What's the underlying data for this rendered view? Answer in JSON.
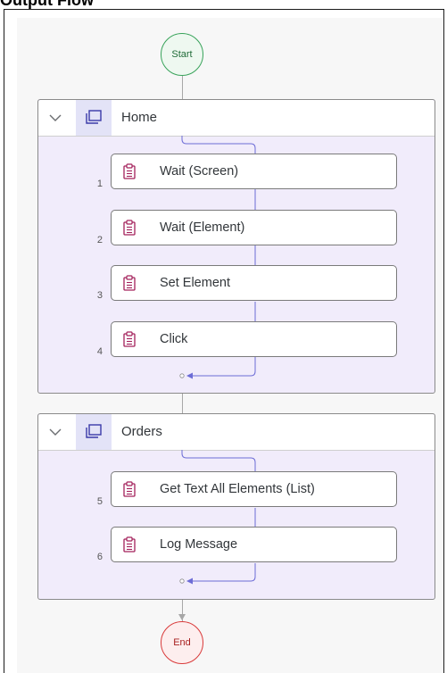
{
  "heading": "Output Flow",
  "flow": {
    "start_label": "Start",
    "end_label": "End",
    "groups": [
      {
        "title": "Home",
        "steps": [
          {
            "number": "1",
            "label": "Wait (Screen)"
          },
          {
            "number": "2",
            "label": "Wait (Element)"
          },
          {
            "number": "3",
            "label": "Set Element"
          },
          {
            "number": "4",
            "label": "Click"
          }
        ]
      },
      {
        "title": "Orders",
        "steps": [
          {
            "number": "5",
            "label": "Get Text All Elements (List)"
          },
          {
            "number": "6",
            "label": "Log Message"
          }
        ]
      }
    ]
  },
  "icons": {
    "group_toggle": "chevron-down-icon",
    "group": "screen-window-icon",
    "step": "clipboard-activity-icon"
  },
  "colors": {
    "start": "#38a35a",
    "end": "#d93a3a",
    "group_background": "#f1ecfb",
    "step_icon": "#a3205b",
    "connector": "#6c6cd6"
  }
}
